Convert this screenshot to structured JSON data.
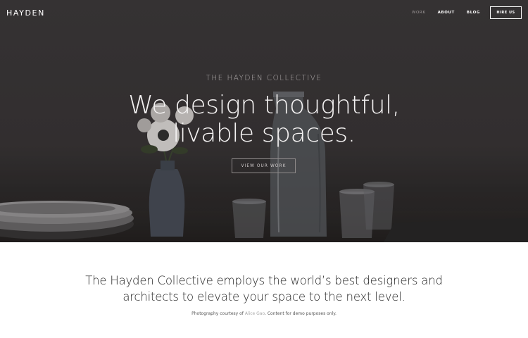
{
  "header": {
    "brand": "HAYDEN",
    "nav": [
      {
        "label": "WORK",
        "active": true
      },
      {
        "label": "ABOUT",
        "active": false
      },
      {
        "label": "BLOG",
        "active": false
      }
    ],
    "cta_label": "HIRE US"
  },
  "hero": {
    "eyebrow": "THE HAYDEN COLLECTIVE",
    "headline_line1": "We design thoughtful,",
    "headline_line2": "livable spaces.",
    "button_label": "VIEW OUR WORK"
  },
  "intro": {
    "line1": "The Hayden Collective employs the world’s best designers and",
    "line2": "architects to elevate your space to the next level."
  },
  "credit": {
    "prefix": "Photography courtesy of ",
    "link_text": "Alice Gao",
    "suffix": ". Content for demo purposes only."
  },
  "colors": {
    "hero_background": "#3d393a",
    "text_dark": "#222222",
    "link_muted": "#a9a9a9"
  }
}
